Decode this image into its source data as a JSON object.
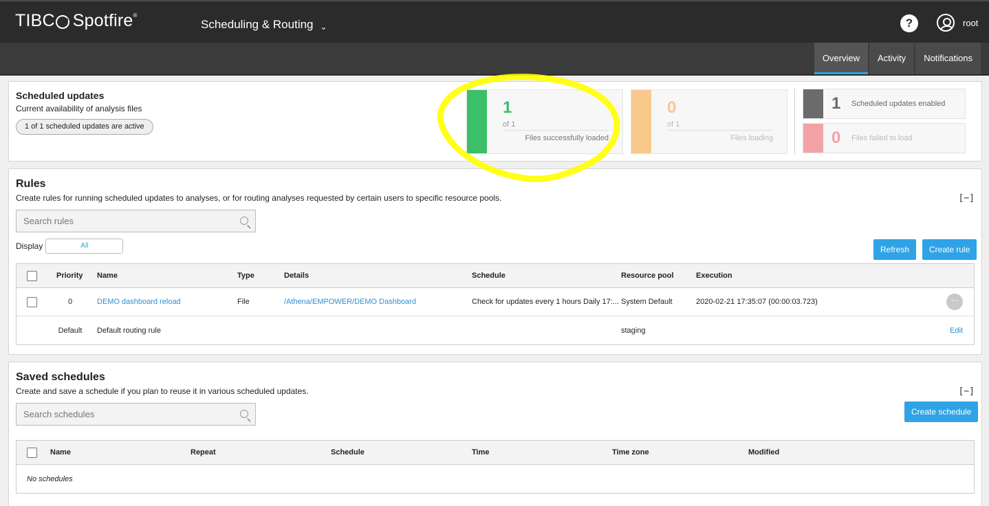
{
  "topbar": {
    "logo_text_a": "TIBC",
    "logo_text_b": "Spotfire",
    "logo_reg": "®",
    "app_title": "Scheduling & Routing",
    "app_chevron": "⌄",
    "help_label": "?",
    "user_name": "root"
  },
  "tabs": [
    {
      "label": "Overview",
      "active": true
    },
    {
      "label": "Activity",
      "active": false
    },
    {
      "label": "Notifications",
      "active": false
    }
  ],
  "scheduled_updates": {
    "title": "Scheduled updates",
    "subtitle": "Current availability of analysis files",
    "active_pill": "1 of 1 scheduled updates are active",
    "loaded": {
      "value": "1",
      "of": "of 1",
      "label": "Files successfully loaded",
      "color": "#3cbf6b"
    },
    "loading": {
      "value": "0",
      "of": "of 1",
      "label": "Files loading",
      "color": "#f9c98c"
    },
    "enabled": {
      "value": "1",
      "label": "Scheduled updates enabled",
      "color": "#6b6b6b"
    },
    "failed": {
      "value": "0",
      "label": "Files failed to load",
      "color": "#f2a3a6"
    }
  },
  "rules": {
    "title": "Rules",
    "description": "Create rules for running scheduled updates to analyses, or for routing analyses requested by certain users to specific resource pools.",
    "collapse": "[−]",
    "search_placeholder": "Search rules",
    "display_label": "Display",
    "display_value": "All",
    "refresh_label": "Refresh",
    "create_label": "Create rule",
    "columns": [
      "Priority",
      "Name",
      "Type",
      "Details",
      "Schedule",
      "Resource pool",
      "Execution"
    ],
    "rows": [
      {
        "priority": "0",
        "name": "DEMO dashboard reload",
        "type": "File",
        "details": "/Athena/EMPOWER/DEMO Dashboard",
        "schedule": "Check for updates every 1 hours Daily 17:...",
        "resource_pool": "System Default",
        "execution": "2020-02-21 17:35:07 (00:00:03.723)",
        "action": "···"
      },
      {
        "priority": "Default",
        "name": "Default routing rule",
        "resource_pool": "staging",
        "action": "Edit"
      }
    ]
  },
  "saved_schedules": {
    "title": "Saved schedules",
    "description": "Create and save a schedule if you plan to reuse it in various scheduled updates.",
    "collapse": "[−]",
    "search_placeholder": "Search schedules",
    "create_label": "Create schedule",
    "columns": [
      "Name",
      "Repeat",
      "Schedule",
      "Time",
      "Time zone",
      "Modified"
    ],
    "empty_text": "No schedules"
  },
  "colors": {
    "accent": "#2fa3e6",
    "highlight_annotation": "#ffff00"
  }
}
